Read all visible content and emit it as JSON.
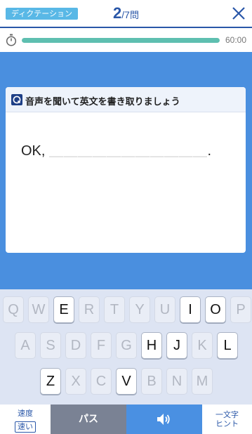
{
  "header": {
    "mode_badge": "ディクテーション",
    "current": "2",
    "total": "/7",
    "unit": "問"
  },
  "timer": {
    "remaining": "60:00",
    "progress_fraction": 1.0
  },
  "card": {
    "instruction": "音声を聞いて英文を書き取りましょう",
    "answer_prefix": "OK,",
    "answer_blanks": "＿＿＿＿＿＿＿＿＿＿＿",
    "answer_suffix": "."
  },
  "keyboard": {
    "rows": [
      [
        {
          "letter": "Q",
          "enabled": false
        },
        {
          "letter": "W",
          "enabled": false
        },
        {
          "letter": "E",
          "enabled": true
        },
        {
          "letter": "R",
          "enabled": false
        },
        {
          "letter": "T",
          "enabled": false
        },
        {
          "letter": "Y",
          "enabled": false
        },
        {
          "letter": "U",
          "enabled": false
        },
        {
          "letter": "I",
          "enabled": true
        },
        {
          "letter": "O",
          "enabled": true
        },
        {
          "letter": "P",
          "enabled": false
        }
      ],
      [
        {
          "letter": "A",
          "enabled": false
        },
        {
          "letter": "S",
          "enabled": false
        },
        {
          "letter": "D",
          "enabled": false
        },
        {
          "letter": "F",
          "enabled": false
        },
        {
          "letter": "G",
          "enabled": false
        },
        {
          "letter": "H",
          "enabled": true
        },
        {
          "letter": "J",
          "enabled": true
        },
        {
          "letter": "K",
          "enabled": false
        },
        {
          "letter": "L",
          "enabled": true
        }
      ],
      [
        {
          "letter": "Z",
          "enabled": true
        },
        {
          "letter": "X",
          "enabled": false
        },
        {
          "letter": "C",
          "enabled": false
        },
        {
          "letter": "V",
          "enabled": true
        },
        {
          "letter": "B",
          "enabled": false
        },
        {
          "letter": "N",
          "enabled": false
        },
        {
          "letter": "M",
          "enabled": false
        }
      ]
    ]
  },
  "bottom": {
    "speed_label": "速度",
    "speed_value": "速い",
    "pass_label": "パス",
    "audio_icon": "speaker-icon",
    "hint_line1": "一文字",
    "hint_line2": "ヒント"
  },
  "colors": {
    "brand_blue": "#2a57a8",
    "stage_blue": "#4a8fdf",
    "progress_teal": "#5ebfb0",
    "pass_gray": "#7a8294",
    "audio_blue": "#4a90e2"
  }
}
